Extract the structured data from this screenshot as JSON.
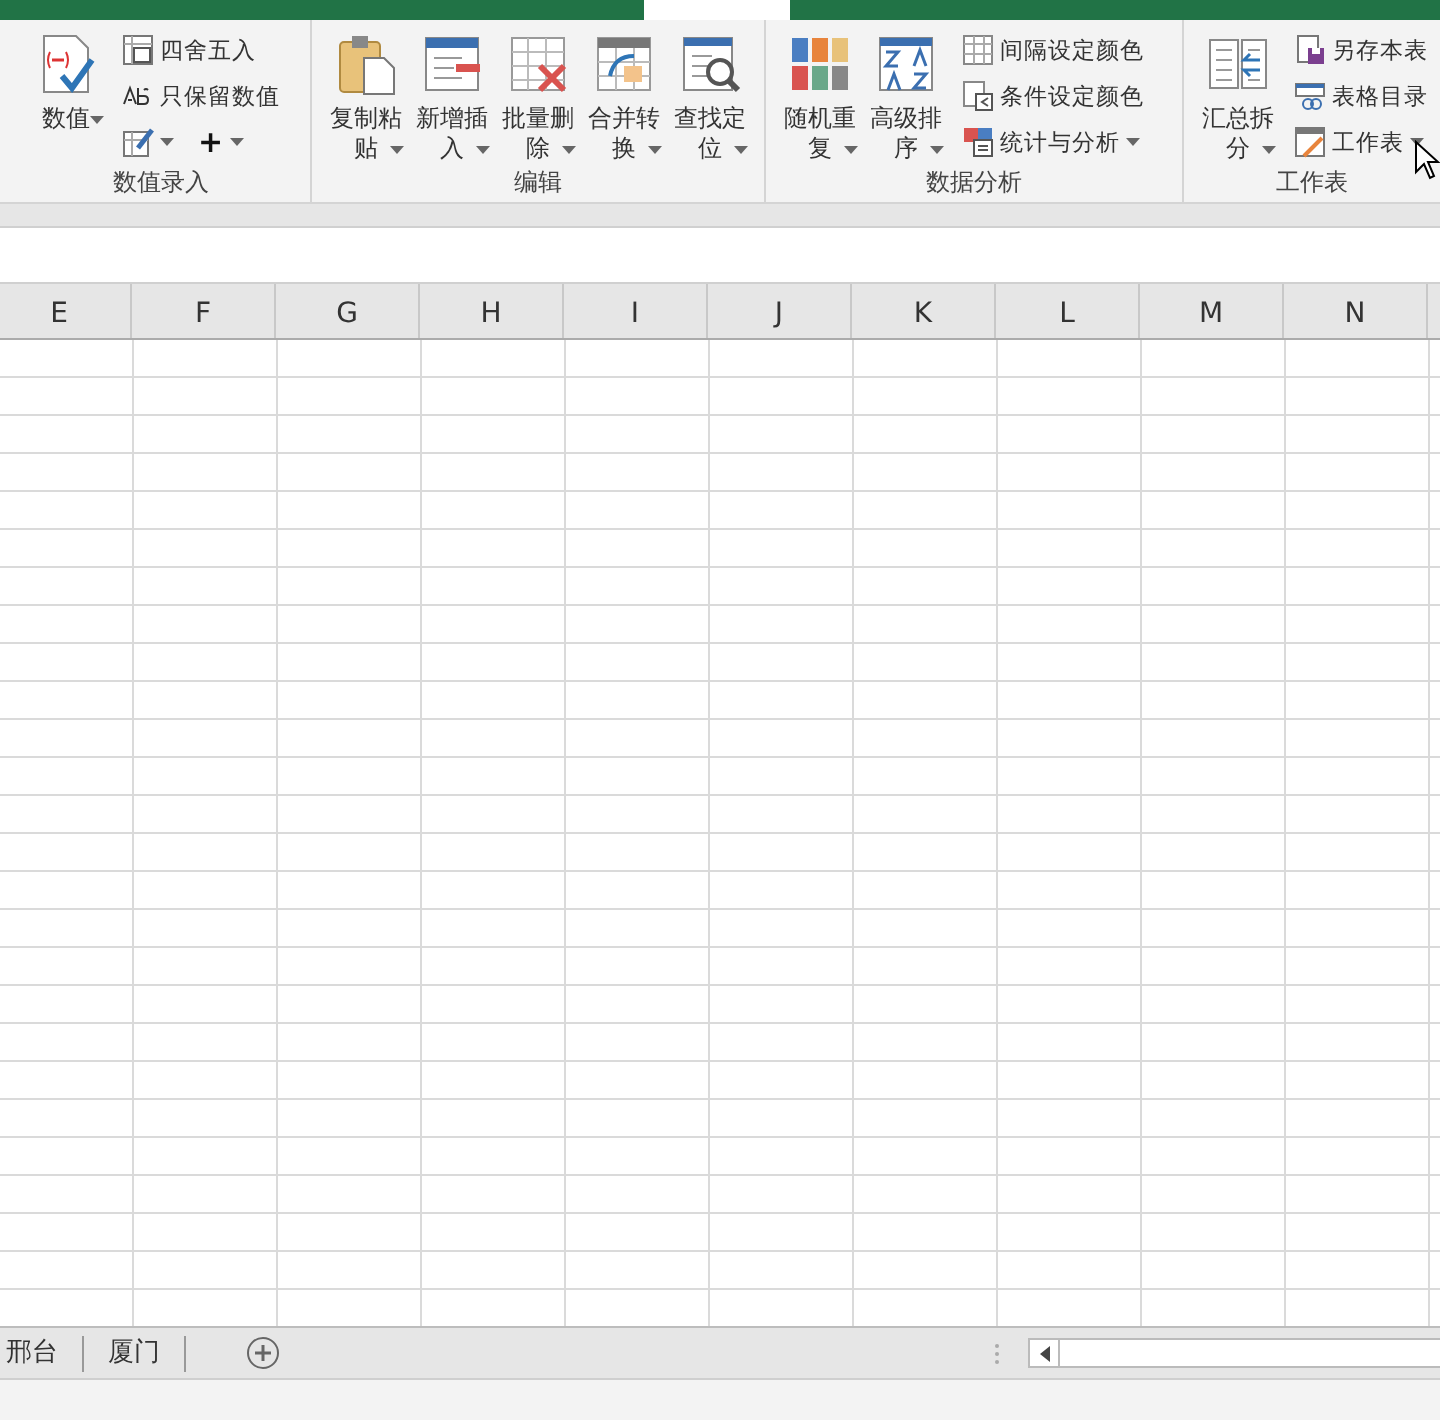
{
  "ribbon": {
    "groups": [
      {
        "label": "数值录入",
        "items": [
          {
            "kind": "large",
            "label": "数值",
            "dropdown": true
          },
          {
            "kind": "stack",
            "items": [
              {
                "kind": "small",
                "label": "四舍五入",
                "dropdown": false
              },
              {
                "kind": "small",
                "label": "只保留数值",
                "dropdown": false
              },
              {
                "kind": "pair",
                "items": [
                  {
                    "kind": "icon",
                    "dropdown": true
                  },
                  {
                    "kind": "glyph",
                    "text": "+",
                    "dropdown": true
                  }
                ]
              }
            ]
          }
        ]
      },
      {
        "label": "编辑",
        "items": [
          {
            "kind": "large",
            "label": "复制粘贴",
            "dropdown": true
          },
          {
            "kind": "large",
            "label": "新增插入",
            "dropdown": true
          },
          {
            "kind": "large",
            "label": "批量删除",
            "dropdown": true
          },
          {
            "kind": "large",
            "label": "合并转换",
            "dropdown": true
          },
          {
            "kind": "large",
            "label": "查找定位",
            "dropdown": true
          }
        ]
      },
      {
        "label": "数据分析",
        "items": [
          {
            "kind": "large",
            "label": "随机重复",
            "dropdown": true
          },
          {
            "kind": "large",
            "label": "高级排序",
            "dropdown": true
          },
          {
            "kind": "stack",
            "items": [
              {
                "kind": "small",
                "label": "间隔设定颜色",
                "dropdown": false
              },
              {
                "kind": "small",
                "label": "条件设定颜色",
                "dropdown": false
              },
              {
                "kind": "small",
                "label": "统计与分析",
                "dropdown": true
              }
            ]
          }
        ]
      },
      {
        "label": "工作表",
        "items": [
          {
            "kind": "large",
            "label": "汇总拆分",
            "dropdown": true
          },
          {
            "kind": "stack",
            "items": [
              {
                "kind": "small",
                "label": "另存本表",
                "dropdown": false
              },
              {
                "kind": "small",
                "label": "表格目录",
                "dropdown": false
              },
              {
                "kind": "small",
                "label": "工作表",
                "dropdown": true
              }
            ]
          }
        ]
      }
    ]
  },
  "columns": [
    "E",
    "F",
    "G",
    "H",
    "I",
    "J",
    "K",
    "L",
    "M",
    "N"
  ],
  "sheet_tabs": [
    {
      "label": "邢台"
    },
    {
      "label": "厦门"
    }
  ]
}
